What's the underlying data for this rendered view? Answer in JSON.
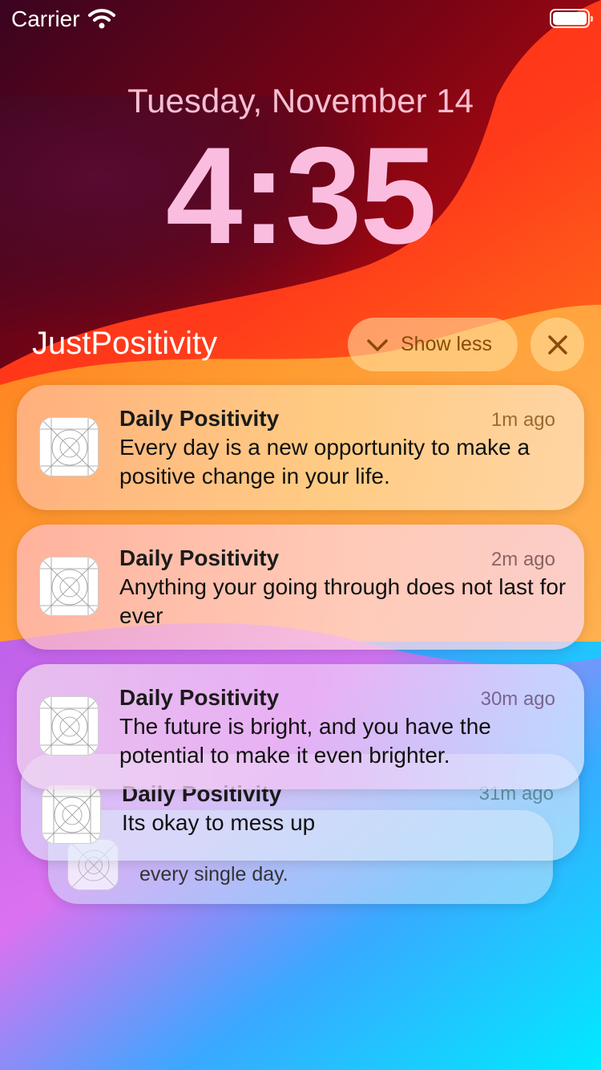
{
  "status_bar": {
    "carrier": "Carrier"
  },
  "lock_screen": {
    "date": "Tuesday, November 14",
    "time": "4:35"
  },
  "notification_group": {
    "title": "JustPositivity",
    "show_less_label": "Show less",
    "notifications": [
      {
        "app": "Daily Positivity",
        "time_ago": "1m ago",
        "message": "Every day is a new opportunity to make a positive change in your life."
      },
      {
        "app": "Daily Positivity",
        "time_ago": "2m ago",
        "message": "Anything your going through does not last for ever"
      },
      {
        "app": "Daily Positivity",
        "time_ago": "30m ago",
        "message": "The future is bright, and you have the potential to make it even brighter."
      },
      {
        "app": "Daily Positivity",
        "time_ago": "31m ago",
        "message": "Its okay to mess up"
      },
      {
        "message": "every single day."
      }
    ]
  },
  "colors": {
    "accent_text": "#8a4a08"
  }
}
